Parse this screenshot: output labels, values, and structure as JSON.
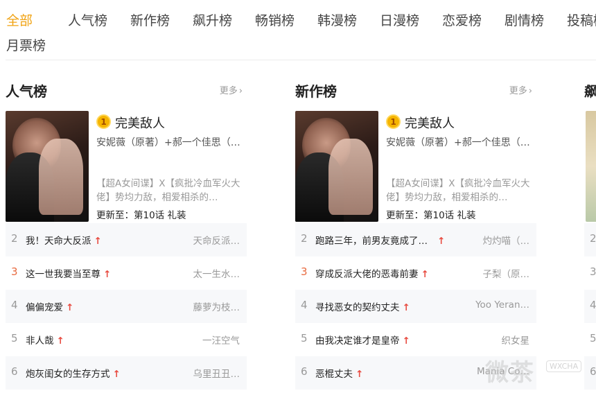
{
  "tabs": [
    {
      "label": "全部",
      "active": true
    },
    {
      "label": "人气榜",
      "active": false
    },
    {
      "label": "新作榜",
      "active": false
    },
    {
      "label": "飙升榜",
      "active": false
    },
    {
      "label": "畅销榜",
      "active": false
    },
    {
      "label": "韩漫榜",
      "active": false
    },
    {
      "label": "日漫榜",
      "active": false
    },
    {
      "label": "恋爱榜",
      "active": false
    },
    {
      "label": "剧情榜",
      "active": false
    },
    {
      "label": "投稿榜",
      "active": false
    },
    {
      "label": "月票榜",
      "active": false
    }
  ],
  "colors": {
    "accent": "#f0a314",
    "rise": "#e84a3f",
    "rank3": "#e86a3f",
    "alt_row": "#f7f8fa"
  },
  "columns": [
    {
      "title": "人气榜",
      "more": "更多",
      "featured": {
        "rank": "1",
        "title": "完美敌人",
        "author": "安妮薇（原著）+郝一个佳思（…",
        "desc": "【超A女间谍】X【疯批冷血军火大佬】势均力敌，相爱相杀的…",
        "update": "更新至：第10话 礼装"
      },
      "rows": [
        {
          "rank": "2",
          "name": "我！天命大反派",
          "up": "↑",
          "author": "天命反派…"
        },
        {
          "rank": "3",
          "name": "这一世我要当至尊",
          "up": "↑",
          "author": "太一生水…"
        },
        {
          "rank": "4",
          "name": "偏偏宠爱",
          "up": "↑",
          "author": "藤萝为枝…"
        },
        {
          "rank": "5",
          "name": "非人哉",
          "up": "↑",
          "author": "一汪空气"
        },
        {
          "rank": "6",
          "name": "炮灰闺女的生存方式",
          "up": "↑",
          "author": "乌里丑丑…"
        }
      ]
    },
    {
      "title": "新作榜",
      "more": "更多",
      "featured": {
        "rank": "1",
        "title": "完美敌人",
        "author": "安妮薇（原著）+郝一个佳思（…",
        "desc": "【超A女间谍】X【疯批冷血军火大佬】势均力敌，相爱相杀的…",
        "update": "更新至：第10话 礼装"
      },
      "rows": [
        {
          "rank": "2",
          "name": "跑路三年，前男友竟成了…",
          "up": "↑",
          "author": "灼灼喵（…"
        },
        {
          "rank": "3",
          "name": "穿成反派大佬的恶毒前妻",
          "up": "↑",
          "author": "子梨（原…"
        },
        {
          "rank": "4",
          "name": "寻找恶女的契约丈夫",
          "up": "↑",
          "author": "Yoo Yeran…"
        },
        {
          "rank": "5",
          "name": "由我决定谁才是皇帝",
          "up": "↑",
          "author": "织女星"
        },
        {
          "rank": "6",
          "name": "恶棍丈夫",
          "up": "↑",
          "author": "Mania Co…"
        }
      ]
    }
  ],
  "third_column": {
    "title": "飙",
    "ranks": [
      "2",
      "3",
      "4",
      "5",
      "6"
    ]
  },
  "watermark": {
    "text": "微茶",
    "sub": "WXCHA"
  }
}
